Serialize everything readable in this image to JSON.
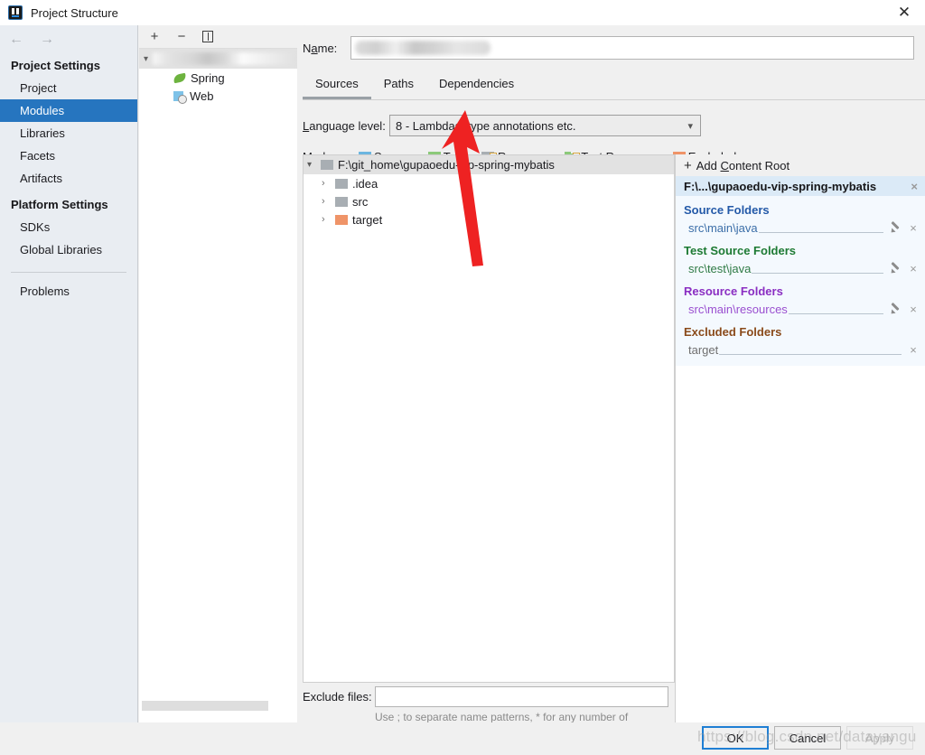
{
  "window": {
    "title": "Project Structure",
    "app_icon": "intellij-idea-icon",
    "close_label": "✕"
  },
  "sidebar": {
    "back_icon": "←",
    "forward_icon": "→",
    "groups": [
      {
        "header": "Project Settings",
        "items": [
          {
            "label": "Project",
            "selected": false
          },
          {
            "label": "Modules",
            "selected": true
          },
          {
            "label": "Libraries",
            "selected": false
          },
          {
            "label": "Facets",
            "selected": false
          },
          {
            "label": "Artifacts",
            "selected": false
          }
        ]
      },
      {
        "header": "Platform Settings",
        "items": [
          {
            "label": "SDKs",
            "selected": false
          },
          {
            "label": "Global Libraries",
            "selected": false
          }
        ]
      }
    ],
    "problems_label": "Problems",
    "help_label": "?"
  },
  "module_list": {
    "toolbar": {
      "add_label": "+",
      "remove_label": "−",
      "copy_label": "copy-icon"
    },
    "root_name_redacted": true,
    "children": [
      {
        "label": "Spring",
        "icon": "spring-icon"
      },
      {
        "label": "Web",
        "icon": "web-icon"
      }
    ]
  },
  "detail": {
    "name_label": "Name:",
    "name_value_redacted": true,
    "tabs": [
      {
        "label": "Sources",
        "active": true
      },
      {
        "label": "Paths",
        "active": false
      },
      {
        "label": "Dependencies",
        "active": false
      }
    ],
    "language_level": {
      "label": "Language level:",
      "value": "8 - Lambdas, type annotations etc.",
      "chevron": "⌄"
    },
    "mark_as": {
      "label": "Mark as:",
      "items": [
        {
          "label": "Sources",
          "color": "#6cb6e0"
        },
        {
          "label": "Tests",
          "color": "#8cc97a"
        },
        {
          "label": "Resources",
          "color": "#a8aeb3"
        },
        {
          "label": "Test Resources",
          "color": "#a8aeb3"
        },
        {
          "label": "Excluded",
          "color": "#ef9468"
        }
      ]
    },
    "tree": {
      "root": {
        "label": "F:\\git_home\\gupaoedu-vip-spring-mybatis",
        "color": "#a8aeb3"
      },
      "rows": [
        {
          "label": ".idea",
          "color": "#a8aeb3"
        },
        {
          "label": "src",
          "color": "#a8aeb3"
        },
        {
          "label": "target",
          "color": "#ef9468"
        }
      ]
    },
    "exclude": {
      "label": "Exclude files:",
      "value": "",
      "hint": "Use ; to separate name patterns, * for any number of symbols, ? for one."
    }
  },
  "content_roots": {
    "add_label": "Add Content Root",
    "add_icon": "plus-icon",
    "root_path": "F:\\...\\gupaoedu-vip-spring-mybatis",
    "groups": [
      {
        "title": "Source Folders",
        "kind": "src",
        "paths": [
          {
            "path": "src\\main\\java",
            "has_edit": true,
            "has_remove": true
          }
        ]
      },
      {
        "title": "Test Source Folders",
        "kind": "test",
        "paths": [
          {
            "path": "src\\test\\java",
            "has_edit": true,
            "has_remove": true
          }
        ]
      },
      {
        "title": "Resource Folders",
        "kind": "res",
        "paths": [
          {
            "path": "src\\main\\resources",
            "has_edit": true,
            "has_remove": true
          }
        ]
      },
      {
        "title": "Excluded Folders",
        "kind": "exc",
        "paths": [
          {
            "path": "target",
            "has_edit": false,
            "has_remove": true
          }
        ]
      }
    ],
    "remove_icon": "×",
    "edit_icon": "pencil-icon"
  },
  "buttons": {
    "ok": "OK",
    "cancel": "Cancel",
    "apply": "Apply"
  },
  "overlay": {
    "watermark": "https://blog.csdn.net/datayangu",
    "annotation_arrow_color": "#ee2222"
  }
}
